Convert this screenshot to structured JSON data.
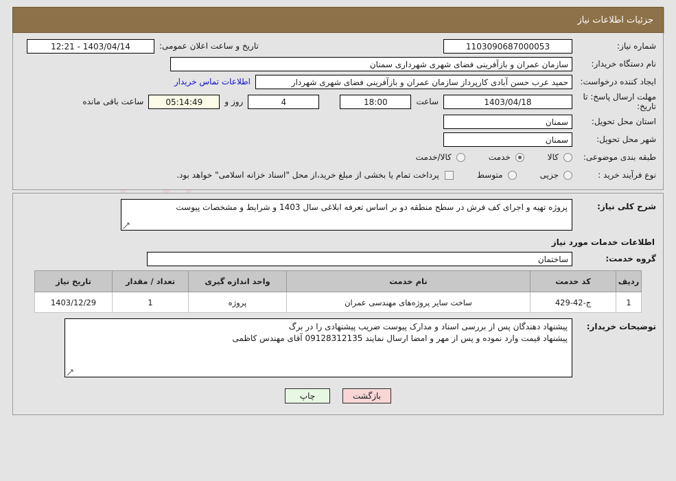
{
  "header": {
    "title": "جزئیات اطلاعات نیاز"
  },
  "form": {
    "need_number_label": "شماره نیاز:",
    "need_number_value": "1103090687000053",
    "public_announce_label": "تاریخ و ساعت اعلان عمومی:",
    "public_announce_value": "1403/04/14 - 12:21",
    "buyer_org_label": "نام دستگاه خریدار:",
    "buyer_org_value": "سازمان عمران و بازآفرینی فضای شهری شهرداری سمنان",
    "creator_label": "ایجاد کننده درخواست:",
    "creator_value": "حمید عرب حسن آبادی کارپرداز سازمان عمران و بازآفرینی فضای شهری شهردار",
    "contact_link": "اطلاعات تماس خریدار",
    "deadline_label": "مهلت ارسال پاسخ: تا تاریخ:",
    "deadline_date": "1403/04/18",
    "hour_label": "ساعت",
    "deadline_time": "18:00",
    "days_value": "4",
    "days_label": "روز و",
    "countdown_value": "05:14:49",
    "remaining_label": "ساعت باقی مانده",
    "province_label": "استان محل تحویل:",
    "province_value": "سمنان",
    "city_label": "شهر محل تحویل:",
    "city_value": "سمنان",
    "category_label": "طبقه بندی موضوعی:",
    "category_options": [
      {
        "label": "کالا",
        "selected": false
      },
      {
        "label": "خدمت",
        "selected": true
      },
      {
        "label": "کالا/خدمت",
        "selected": false
      }
    ],
    "purchase_type_label": "نوع فرآیند خرید :",
    "purchase_type_options": [
      {
        "label": "جزیی",
        "selected": false
      },
      {
        "label": "متوسط",
        "selected": false
      }
    ],
    "treasury_checkbox_label": "پرداخت تمام یا بخشی از مبلغ خرید،از محل \"اسناد خزانه اسلامی\" خواهد بود.",
    "treasury_checked": false
  },
  "description": {
    "label": "شرح کلی نیاز:",
    "value": "پروژه تهیه و اجرای کف فرش در سطح منطقه دو بر اساس تعرفه ابلاغی سال 1403 و شرایط و مشخصات پیوست"
  },
  "services": {
    "section_title": "اطلاعات خدمات مورد نیاز",
    "group_label": "گروه خدمت:",
    "group_value": "ساختمان",
    "columns": [
      "ردیف",
      "کد خدمت",
      "نام خدمت",
      "واحد اندازه گیری",
      "تعداد / مقدار",
      "تاریخ نیاز"
    ],
    "rows": [
      {
        "index": "1",
        "code": "ج-42-429",
        "name": "ساخت سایر پروژه‌های مهندسی عمران",
        "unit": "پروژه",
        "qty": "1",
        "date": "1403/12/29"
      }
    ]
  },
  "notes": {
    "label": "توضیحات خریدار:",
    "line1": "پیشنهاد دهندگان پس از بررسی اسناد و مدارک پیوست ضریب پیشنهادی را در برگ",
    "line2": "پیشنهاد قیمت وارد نموده و پس از مهر و امضا ارسال نمایند 09128312135 آقای مهندس کاظمی"
  },
  "footer": {
    "print_label": "چاپ",
    "back_label": "بازگشت"
  },
  "colors": {
    "header_bg": "#8d7148",
    "link": "#1111cc",
    "print_btn": "#e8f7e4",
    "back_btn": "#f9d6d6"
  }
}
